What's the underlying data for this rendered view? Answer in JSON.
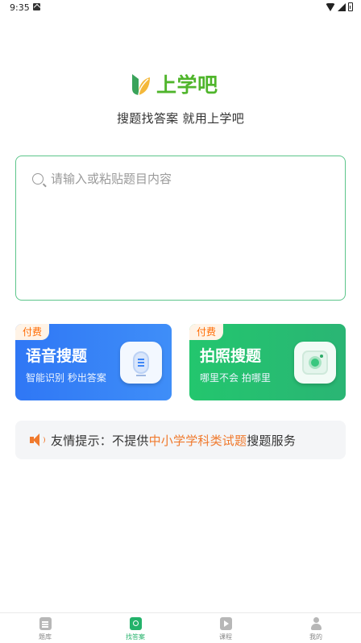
{
  "status_bar": {
    "time": "9:35"
  },
  "brand": {
    "name": "上学吧",
    "slogan": "搜题找答案 就用上学吧",
    "color": "#4fb52b"
  },
  "search": {
    "placeholder": "请输入或粘贴题目内容"
  },
  "cards": [
    {
      "badge": "付费",
      "title": "语音搜题",
      "subtitle": "智能识别 秒出答案",
      "icon": "microphone-icon",
      "color": "#2f77f5"
    },
    {
      "badge": "付费",
      "title": "拍照搜题",
      "subtitle": "哪里不会 拍哪里",
      "icon": "camera-icon",
      "color": "#23c66e"
    }
  ],
  "tip": {
    "prefix": "友情提示：不提供",
    "highlight": "中小学学科类试题",
    "suffix": "搜题服务",
    "highlight_color": "#f07a2e"
  },
  "bottom_nav": [
    {
      "label": "题库",
      "icon": "document-icon",
      "active": false
    },
    {
      "label": "找答案",
      "icon": "search-answer-icon",
      "active": true
    },
    {
      "label": "课程",
      "icon": "play-icon",
      "active": false
    },
    {
      "label": "我的",
      "icon": "user-icon",
      "active": false
    }
  ],
  "accent_color": "#23b26a"
}
